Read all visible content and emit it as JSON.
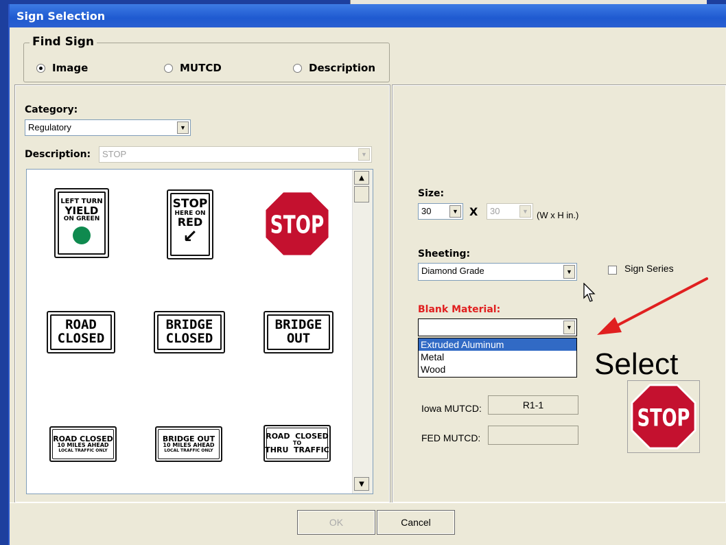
{
  "window": {
    "title": "Sign Selection"
  },
  "find_sign": {
    "legend": "Find Sign",
    "options": [
      {
        "label": "Image",
        "checked": true
      },
      {
        "label": "MUTCD",
        "checked": false
      },
      {
        "label": "Description",
        "checked": false
      }
    ]
  },
  "left": {
    "category_label": "Category:",
    "category_value": "Regulatory",
    "description_label": "Description:",
    "description_value": "STOP"
  },
  "signs": [
    {
      "name": "left-turn-yield-sign",
      "lines": [
        "LEFT TURN",
        "YIELD",
        "ON GREEN"
      ]
    },
    {
      "name": "stop-here-on-red-sign",
      "lines": [
        "STOP",
        "HERE  ON",
        "RED"
      ]
    },
    {
      "name": "stop-sign",
      "lines": [
        "STOP"
      ]
    },
    {
      "name": "road-closed-sign",
      "lines": [
        "ROAD",
        "CLOSED"
      ]
    },
    {
      "name": "bridge-closed-sign",
      "lines": [
        "BRIDGE",
        "CLOSED"
      ]
    },
    {
      "name": "bridge-out-sign",
      "lines": [
        "BRIDGE",
        "OUT"
      ]
    },
    {
      "name": "road-closed-ahead-sign",
      "lines": [
        "ROAD CLOSED",
        "10 MILES AHEAD",
        "LOCAL TRAFFIC ONLY"
      ]
    },
    {
      "name": "bridge-out-ahead-sign",
      "lines": [
        "BRIDGE OUT",
        "10 MILES AHEAD",
        "LOCAL TRAFFIC ONLY"
      ]
    },
    {
      "name": "road-closed-thru-sign",
      "lines": [
        "ROAD  CLOSED",
        "TO",
        "THRU  TRAFFIC"
      ]
    }
  ],
  "right": {
    "size_label": "Size:",
    "width_value": "30",
    "x_symbol": "X",
    "height_value": "30",
    "unit_label": "(W x H in.)",
    "sheeting_label": "Sheeting:",
    "sheeting_value": "Diamond Grade",
    "sign_series_label": "Sign Series",
    "blank_material_label": "Blank Material:",
    "blank_material_value": "",
    "blank_material_options": [
      "Extruded Aluminum",
      "Metal",
      "Wood"
    ],
    "iowa_mutcd_label": "Iowa MUTCD:",
    "iowa_mutcd_value": "R1-1",
    "fed_mutcd_label": "FED MUTCD:",
    "fed_mutcd_value": "",
    "preview_text": "STOP"
  },
  "annotation": {
    "text": "Select",
    "arrow_color": "#e02020"
  },
  "buttons": {
    "ok": "OK",
    "cancel": "Cancel"
  },
  "colors": {
    "stop_red": "#c4112f",
    "title_blue": "#2a5fd1",
    "green_light": "#0f8a4f"
  }
}
